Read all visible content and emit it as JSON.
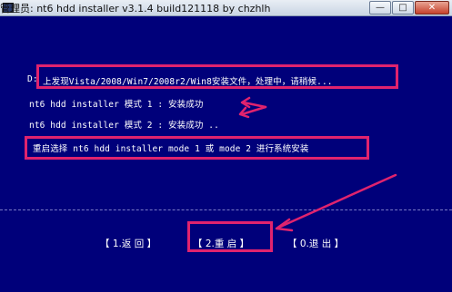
{
  "window": {
    "title": "管理员:  nt6 hdd installer v3.1.4 build121118 by chzhlh",
    "buttons": {
      "minimize": "—",
      "maximize": "□",
      "close": "✕"
    }
  },
  "console": {
    "drive_label": "D:",
    "found_message": "上发现Vista/2008/Win7/2008r2/Win8安装文件，处理中，请稍候...",
    "mode1_line": "nt6 hdd installer 模式 1 : 安装成功",
    "mode2_line": "nt6 hdd installer 模式 2 : 安装成功 ..",
    "restart_note": "重启选择 nt6 hdd installer mode 1 或 mode 2 进行系统安装"
  },
  "menu": {
    "back": "【 1.返 回 】",
    "restart": "【 2.重 启 】",
    "exit": "【 0.退 出 】"
  },
  "colors": {
    "background": "#00007a",
    "text": "#ffffff",
    "highlight": "#e0236e"
  }
}
